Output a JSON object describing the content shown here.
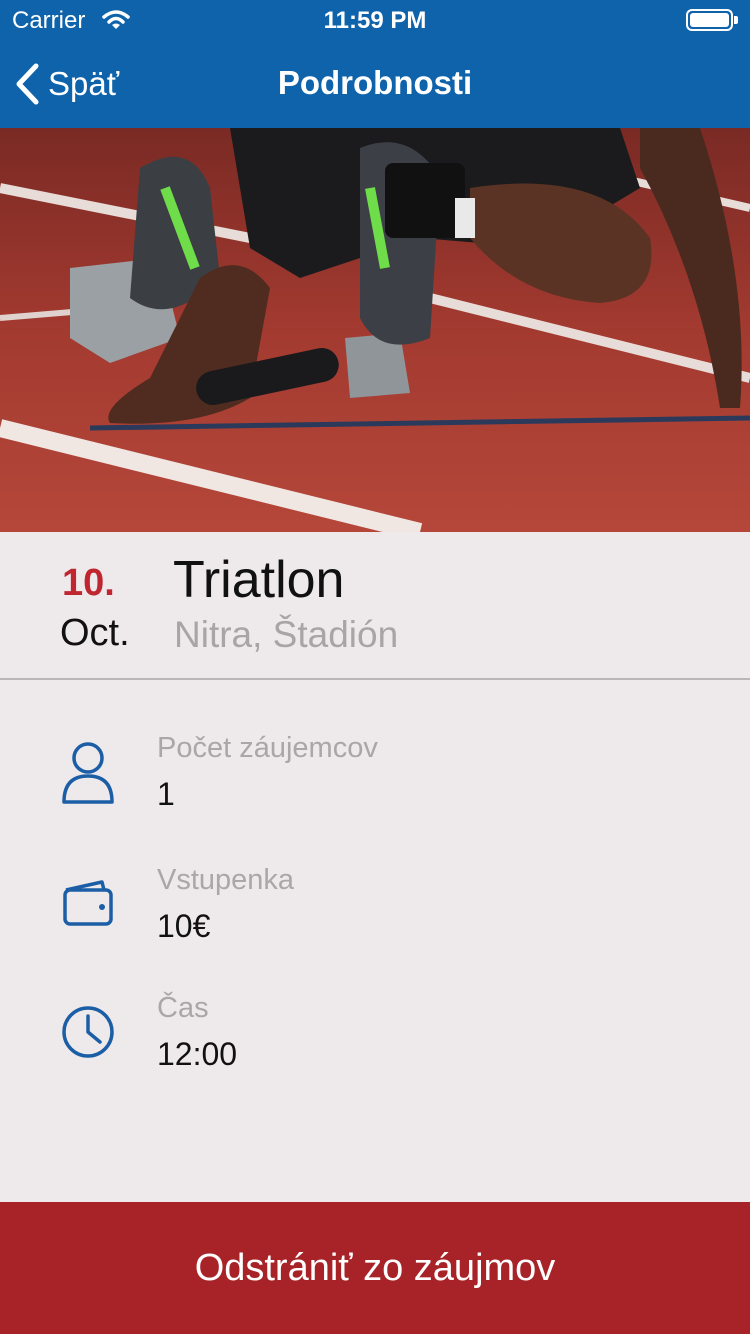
{
  "status_bar": {
    "carrier": "Carrier",
    "time": "11:59 PM"
  },
  "nav": {
    "back_label": "Späť",
    "title": "Podrobnosti"
  },
  "event": {
    "day": "10.",
    "month": "Oct.",
    "title": "Triatlon",
    "place": "Nitra, Štadión"
  },
  "details": [
    {
      "icon": "person-icon",
      "label": "Počet záujemcov",
      "value": "1"
    },
    {
      "icon": "wallet-icon",
      "label": "Vstupenka",
      "value": "10€"
    },
    {
      "icon": "clock-icon",
      "label": "Čas",
      "value": "12:00"
    }
  ],
  "action": {
    "label": "Odstrániť zo záujmov"
  },
  "colors": {
    "nav": "#0f63ab",
    "accent": "#c0262f",
    "button": "#a72327",
    "background": "#eeeaeb"
  }
}
